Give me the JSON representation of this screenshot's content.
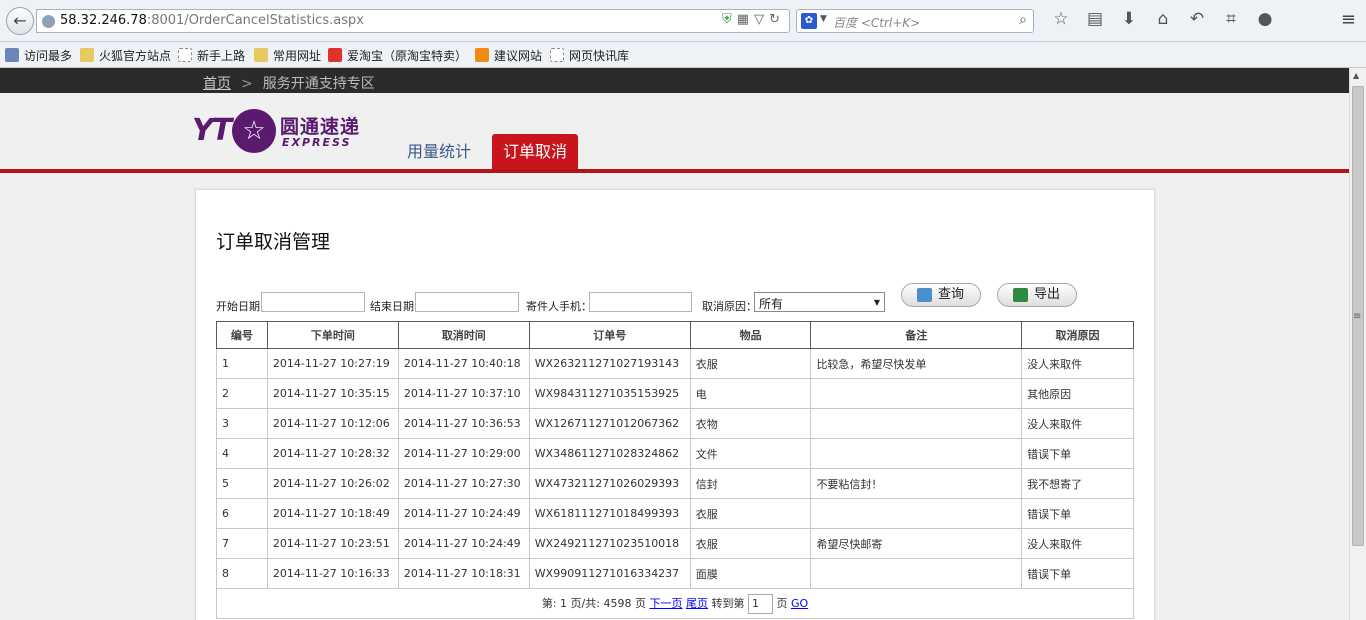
{
  "browser": {
    "url_host": "58.32.246.78",
    "url_rest": ":8001/OrderCancelStatistics.aspx",
    "search_placeholder": "百度 <Ctrl+K>"
  },
  "bookmarks": [
    "访问最多",
    "火狐官方站点",
    "新手上路",
    "常用网址",
    "爱淘宝（原淘宝特卖）",
    "建议网站",
    "网页快讯库"
  ],
  "breadcrumb": {
    "home": "首页",
    "current": "服务开通支持专区"
  },
  "logo": {
    "yt": "YT",
    "cn": "圆通速递",
    "en": "EXPRESS"
  },
  "nav": {
    "tab1": "用量统计",
    "tab2": "订单取消"
  },
  "panel": {
    "title": "订单取消管理"
  },
  "filters": {
    "start_label": "开始日期:",
    "end_label": "结束日期:",
    "phone_label": "寄件人手机：",
    "reason_label": "取消原因：",
    "reason_value": "所有",
    "query_label": "查询",
    "export_label": "导出"
  },
  "table": {
    "headers": [
      "编号",
      "下单时间",
      "取消时间",
      "订单号",
      "物品",
      "备注",
      "取消原因"
    ],
    "rows": [
      [
        "1",
        "2014-11-27 10:27:19",
        "2014-11-27 10:40:18",
        "WX263211271027193143",
        "衣服",
        "比较急，希望尽快发单",
        "没人来取件"
      ],
      [
        "2",
        "2014-11-27 10:35:15",
        "2014-11-27 10:37:10",
        "WX984311271035153925",
        "电",
        "",
        "其他原因"
      ],
      [
        "3",
        "2014-11-27 10:12:06",
        "2014-11-27 10:36:53",
        "WX126711271012067362",
        "衣物",
        "",
        "没人来取件"
      ],
      [
        "4",
        "2014-11-27 10:28:32",
        "2014-11-27 10:29:00",
        "WX348611271028324862",
        "文件",
        "",
        "错误下单"
      ],
      [
        "5",
        "2014-11-27 10:26:02",
        "2014-11-27 10:27:30",
        "WX473211271026029393",
        "信封",
        "不要粘信封！",
        "我不想寄了"
      ],
      [
        "6",
        "2014-11-27 10:18:49",
        "2014-11-27 10:24:49",
        "WX618111271018499393",
        "衣服",
        "",
        "错误下单"
      ],
      [
        "7",
        "2014-11-27 10:23:51",
        "2014-11-27 10:24:49",
        "WX249211271023510018",
        "衣服",
        "希望尽快邮寄",
        "没人来取件"
      ],
      [
        "8",
        "2014-11-27 10:16:33",
        "2014-11-27 10:18:31",
        "WX990911271016334237",
        "面膜",
        "",
        "错误下单"
      ]
    ]
  },
  "pager": {
    "info": "第: 1 页/共: 4598 页",
    "next": "下一页",
    "last": "尾页",
    "goto_label": "转到第",
    "page_value": "1",
    "page_suffix": "页",
    "go": "GO"
  }
}
